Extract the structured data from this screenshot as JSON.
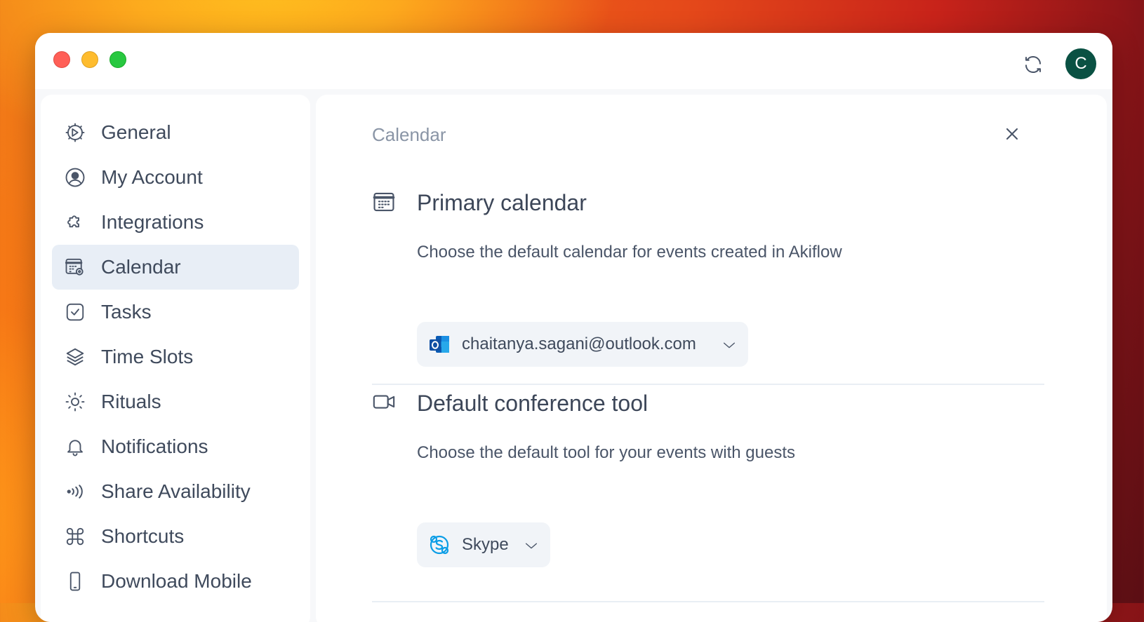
{
  "titlebar": {
    "avatar_initial": "C"
  },
  "sidebar": {
    "items": [
      {
        "label": "General",
        "icon": "gear-icon"
      },
      {
        "label": "My Account",
        "icon": "user-circle-icon"
      },
      {
        "label": "Integrations",
        "icon": "puzzle-icon"
      },
      {
        "label": "Calendar",
        "icon": "calendar-settings-icon",
        "active": true
      },
      {
        "label": "Tasks",
        "icon": "checkbox-icon"
      },
      {
        "label": "Time Slots",
        "icon": "layers-icon"
      },
      {
        "label": "Rituals",
        "icon": "sun-icon"
      },
      {
        "label": "Notifications",
        "icon": "bell-icon"
      },
      {
        "label": "Share Availability",
        "icon": "broadcast-icon"
      },
      {
        "label": "Shortcuts",
        "icon": "command-icon"
      },
      {
        "label": "Download Mobile",
        "icon": "phone-icon"
      }
    ]
  },
  "main": {
    "breadcrumb": "Calendar",
    "primary_calendar": {
      "title": "Primary calendar",
      "description": "Choose the default calendar for events created in Akiflow",
      "selected": "chaitanya.sagani@outlook.com",
      "selected_icon": "outlook-icon"
    },
    "conference_tool": {
      "title": "Default conference tool",
      "description": "Choose the default tool for your events with guests",
      "selected": "Skype",
      "selected_icon": "skype-icon"
    }
  },
  "colors": {
    "accent_active_bg": "#e8eef6",
    "avatar_bg": "#0a5143",
    "text_primary": "#3f4a5c",
    "text_muted": "#8a95a6"
  }
}
